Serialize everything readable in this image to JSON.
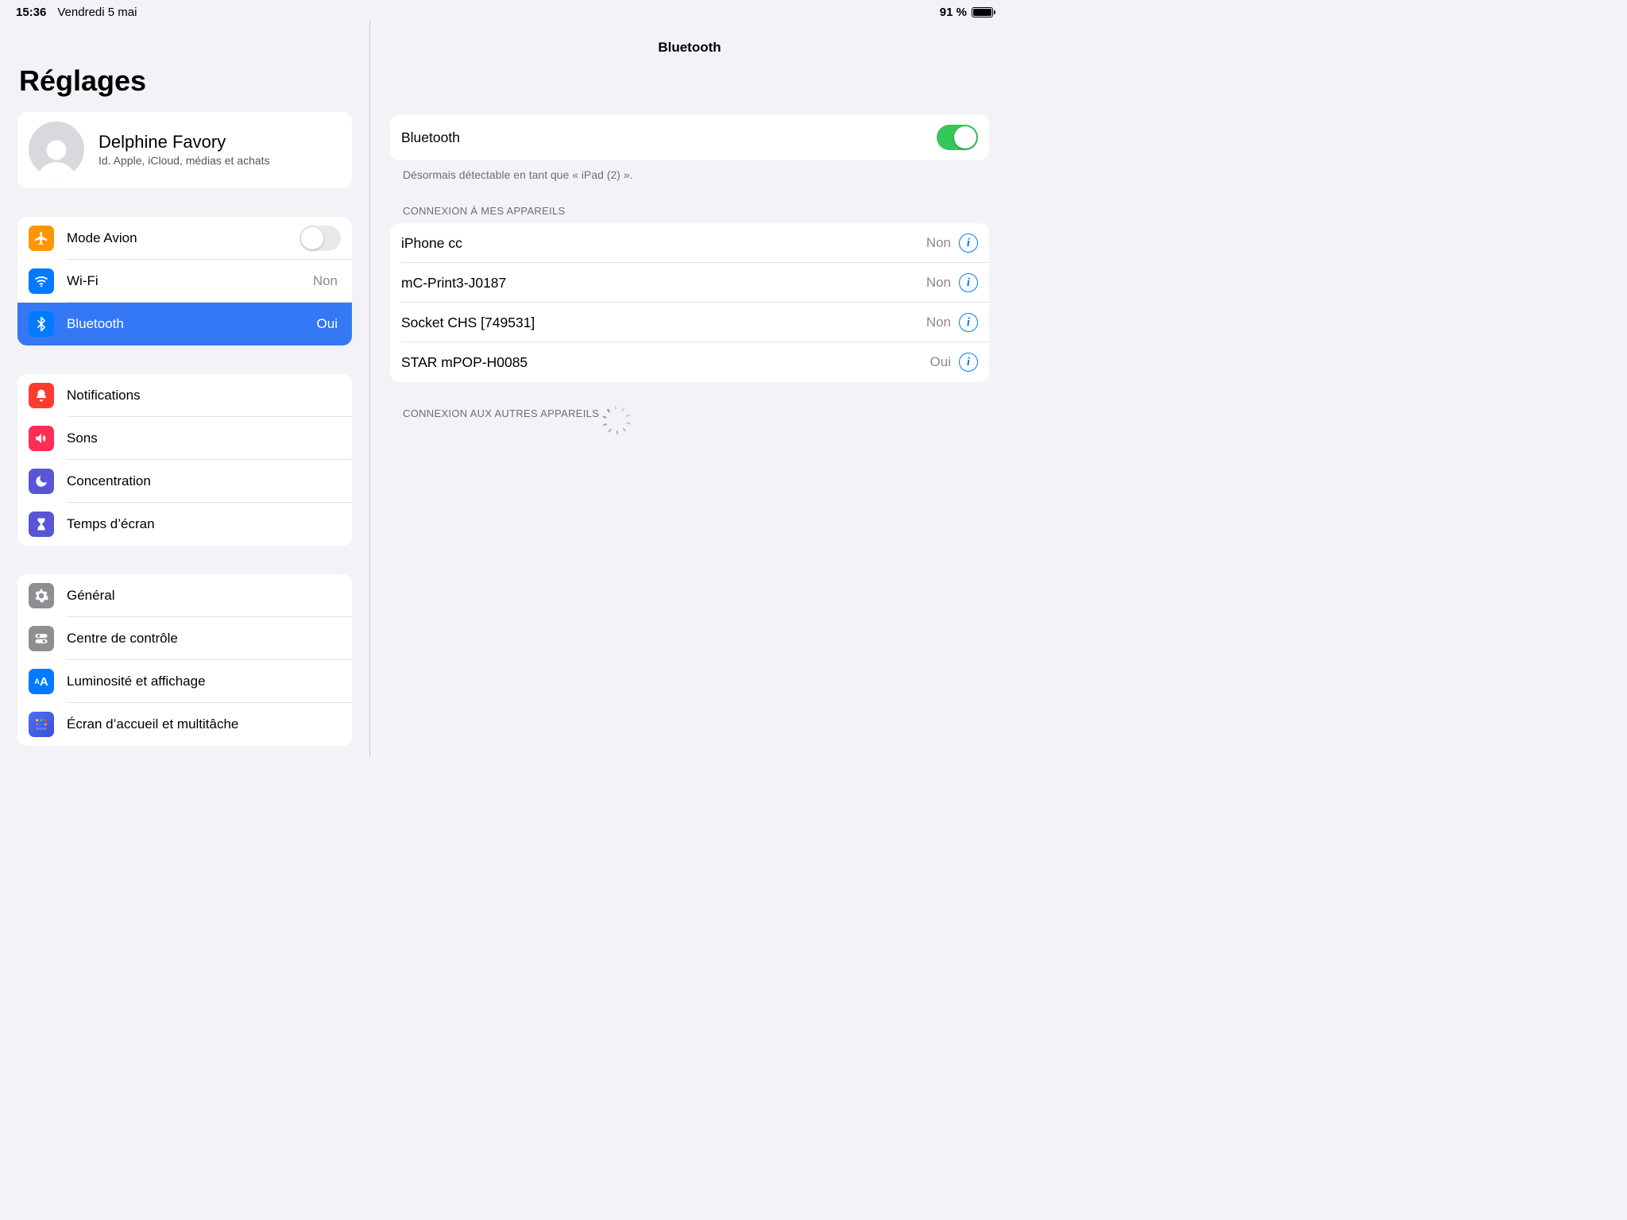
{
  "statusbar": {
    "time": "15:36",
    "date": "Vendredi 5 mai",
    "battery_pct": "91 %"
  },
  "sidebar": {
    "title": "Réglages",
    "profile": {
      "name": "Delphine Favory",
      "sub": "Id. Apple, iCloud, médias et achats"
    },
    "group1": {
      "airplane": "Mode Avion",
      "wifi": "Wi-Fi",
      "wifi_value": "Non",
      "bt": "Bluetooth",
      "bt_value": "Oui"
    },
    "group2": {
      "notif": "Notifications",
      "sounds": "Sons",
      "focus": "Concentration",
      "screentime": "Temps d’écran"
    },
    "group3": {
      "general": "Général",
      "control": "Centre de contrôle",
      "display": "Luminosité et affichage",
      "home": "Écran d’accueil et multitâche"
    }
  },
  "detail": {
    "title": "Bluetooth",
    "toggle_label": "Bluetooth",
    "footer": "Désormais détectable en tant que « iPad (2) ».",
    "my_devices_header": "CONNEXION À MES APPAREILS",
    "devices": [
      {
        "name": "iPhone cc",
        "status": "Non"
      },
      {
        "name": "mC-Print3-J0187",
        "status": "Non"
      },
      {
        "name": "Socket CHS [749531]",
        "status": "Non"
      },
      {
        "name": "STAR mPOP-H0085",
        "status": "Oui"
      }
    ],
    "other_devices_header": "CONNEXION AUX AUTRES APPAREILS"
  }
}
